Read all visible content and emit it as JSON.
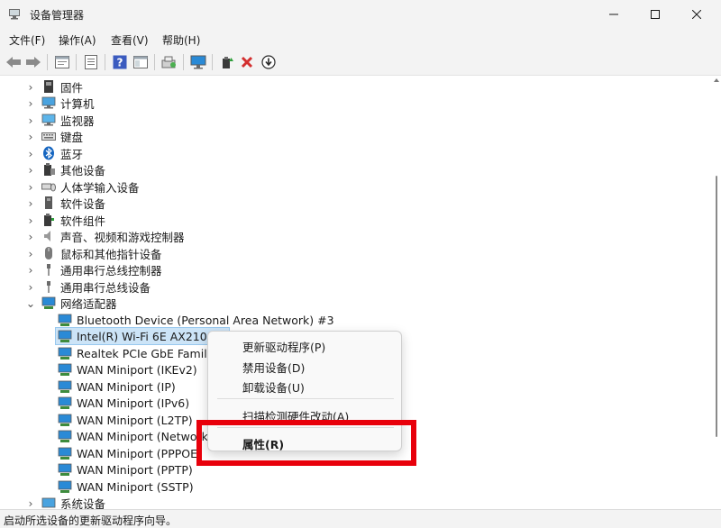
{
  "window": {
    "title": "设备管理器"
  },
  "menu": [
    "文件(F)",
    "操作(A)",
    "查看(V)",
    "帮助(H)"
  ],
  "toolbar": {
    "buttons": [
      "back-icon",
      "forward-icon",
      "properties-icon",
      "tree-view-icon",
      "help-icon",
      "console-icon",
      "scan-hardware-icon",
      "monitor-icon",
      "add-driver-icon",
      "disable-icon",
      "uninstall-down-icon"
    ]
  },
  "tree": {
    "categories": [
      {
        "label": "固件",
        "icon": "firmware-icon"
      },
      {
        "label": "计算机",
        "icon": "computer-icon"
      },
      {
        "label": "监视器",
        "icon": "monitor-icon"
      },
      {
        "label": "键盘",
        "icon": "keyboard-icon"
      },
      {
        "label": "蓝牙",
        "icon": "bluetooth-icon"
      },
      {
        "label": "其他设备",
        "icon": "other-devices-icon"
      },
      {
        "label": "人体学输入设备",
        "icon": "hid-icon"
      },
      {
        "label": "软件设备",
        "icon": "software-device-icon"
      },
      {
        "label": "软件组件",
        "icon": "software-component-icon"
      },
      {
        "label": "声音、视频和游戏控制器",
        "icon": "sound-icon"
      },
      {
        "label": "鼠标和其他指针设备",
        "icon": "mouse-icon"
      },
      {
        "label": "通用串行总线控制器",
        "icon": "usb-icon"
      },
      {
        "label": "通用串行总线设备",
        "icon": "usb-device-icon"
      },
      {
        "label": "网络适配器",
        "icon": "network-adapter-icon"
      }
    ],
    "network_children": [
      "Bluetooth Device (Personal Area Network) #3",
      "Intel(R) Wi-Fi 6E AX210 16",
      "Realtek PCIe GbE Family C",
      "WAN Miniport (IKEv2)",
      "WAN Miniport (IP)",
      "WAN Miniport (IPv6)",
      "WAN Miniport (L2TP)",
      "WAN Miniport (Network M",
      "WAN Miniport (PPPOE",
      "WAN Miniport (PPTP)",
      "WAN Miniport (SSTP)"
    ],
    "last_category": "系统设备"
  },
  "context_menu": {
    "update_driver": "更新驱动程序(P)",
    "disable_device": "禁用设备(D)",
    "uninstall_device": "卸载设备(U)",
    "scan_changes": "扫描检测硬件改动(A)",
    "properties": "属性(R)"
  },
  "status": {
    "text": "启动所选设备的更新驱动程序向导。"
  },
  "colors": {
    "highlight": "#e8000b",
    "selection": "#cce4f7",
    "network_icon": "#1e88d6"
  }
}
